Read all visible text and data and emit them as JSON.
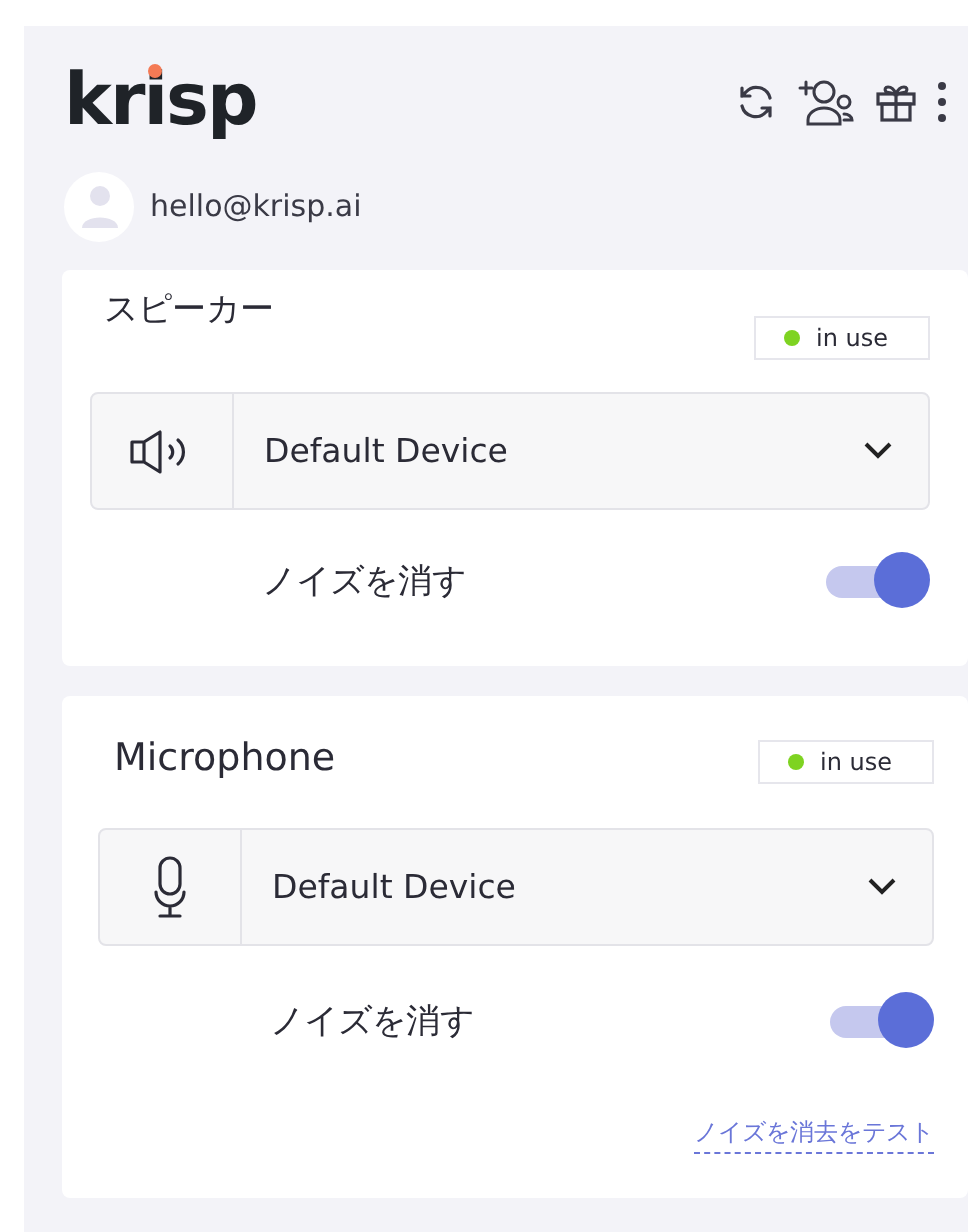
{
  "header": {
    "logo": "krisp",
    "account": "hello@krisp.ai"
  },
  "cards": [
    {
      "kind": "speaker",
      "title": "スピーカー",
      "status": {
        "label": "in use",
        "color": "#7ed321"
      },
      "device": "Default Device",
      "toggle": {
        "label": "ノイズを消す",
        "on": true
      }
    },
    {
      "kind": "microphone",
      "title": "Microphone",
      "status": {
        "label": "in use",
        "color": "#7ed321"
      },
      "device": "Default Device",
      "toggle": {
        "label": "ノイズを消す",
        "on": true
      },
      "link": "ノイズを消去をテスト"
    }
  ]
}
